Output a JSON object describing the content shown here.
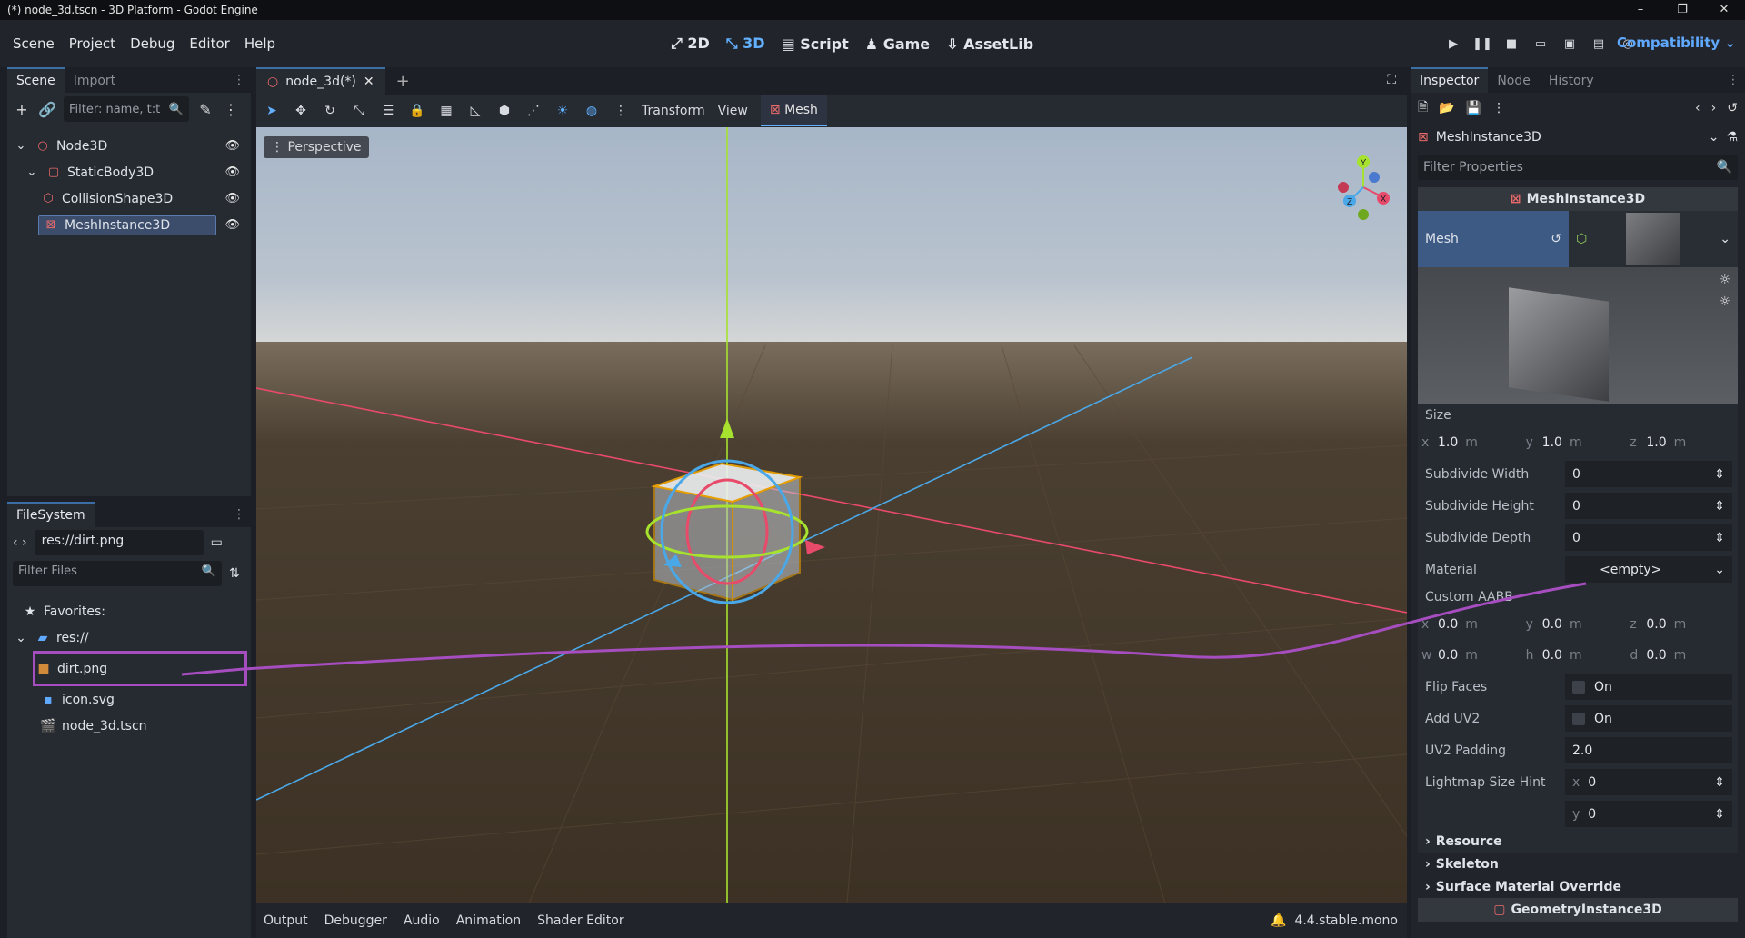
{
  "window": {
    "title": "(*) node_3d.tscn - 3D Platform - Godot Engine",
    "controls": [
      "–",
      "❐",
      "✕"
    ]
  },
  "menubar": {
    "menus": [
      "Scene",
      "Project",
      "Debug",
      "Editor",
      "Help"
    ],
    "modes": [
      "2D",
      "3D",
      "Script",
      "Game",
      "AssetLib"
    ],
    "active_mode": "3D",
    "renderer": "Compatibility"
  },
  "scene_dock": {
    "tabs": [
      "Scene",
      "Import"
    ],
    "filter_placeholder": "Filter: name, t:t",
    "nodes": [
      {
        "label": "Node3D",
        "icon": "node3d-icon",
        "color": "#e86a6a"
      },
      {
        "label": "StaticBody3D",
        "icon": "staticbody-icon",
        "color": "#e86a6a"
      },
      {
        "label": "CollisionShape3D",
        "icon": "collision-shape-icon",
        "color": "#e86a6a"
      },
      {
        "label": "MeshInstance3D",
        "icon": "mesh-instance-icon",
        "color": "#e86a6a"
      }
    ]
  },
  "filesystem": {
    "tab": "FileSystem",
    "path": "res://dirt.png",
    "filter_placeholder": "Filter Files",
    "favorites": "Favorites:",
    "root": "res://",
    "files": [
      {
        "label": "dirt.png",
        "icon": "image-icon"
      },
      {
        "label": "icon.svg",
        "icon": "svg-icon"
      },
      {
        "label": "node_3d.tscn",
        "icon": "scene-icon"
      }
    ]
  },
  "editor": {
    "tab_title": "node_3d(*)",
    "menus": [
      "Transform",
      "View",
      "Mesh"
    ],
    "viewport_label": "Perspective",
    "bottom_tabs": [
      "Output",
      "Debugger",
      "Audio",
      "Animation",
      "Shader Editor"
    ],
    "version": "4.4.stable.mono",
    "gizmo_axes": [
      "Y",
      "X",
      "Z"
    ]
  },
  "inspector": {
    "tabs": [
      "Inspector",
      "Node",
      "History"
    ],
    "object": "MeshInstance3D",
    "filter_placeholder": "Filter Properties",
    "section": "MeshInstance3D",
    "mesh_label": "Mesh",
    "size_label": "Size",
    "size": {
      "x": "1.0",
      "y": "1.0",
      "z": "1.0",
      "unit": "m"
    },
    "subdivide_width": {
      "label": "Subdivide Width",
      "value": "0"
    },
    "subdivide_height": {
      "label": "Subdivide Height",
      "value": "0"
    },
    "subdivide_depth": {
      "label": "Subdivide Depth",
      "value": "0"
    },
    "material": {
      "label": "Material",
      "value": "<empty>"
    },
    "custom_aabb_label": "Custom AABB",
    "custom_aabb": {
      "x": "0.0",
      "y": "0.0",
      "z": "0.0",
      "w": "0.0",
      "h": "0.0",
      "d": "0.0",
      "unit": "m"
    },
    "flip_faces": {
      "label": "Flip Faces",
      "value": "On"
    },
    "add_uv2": {
      "label": "Add UV2",
      "value": "On"
    },
    "uv2_padding": {
      "label": "UV2 Padding",
      "value": "2.0"
    },
    "lightmap_size_hint": {
      "label": "Lightmap Size Hint",
      "x": "0",
      "y": "0"
    },
    "resource": "Resource",
    "skeleton": "Skeleton",
    "surface_override": "Surface Material Override",
    "geometry_section": "GeometryInstance3D"
  },
  "colors": {
    "accent": "#62b0ff",
    "annotation": "#a64dc0",
    "x_axis": "#e84a6a",
    "y_axis": "#a6e22e",
    "z_axis": "#4aa8e8"
  }
}
